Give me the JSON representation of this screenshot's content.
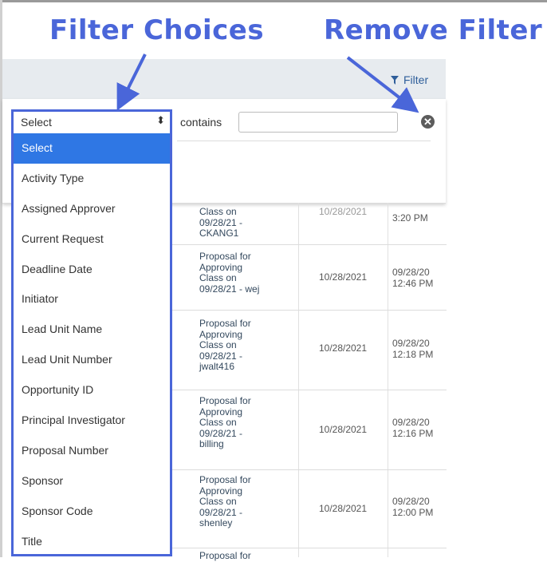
{
  "callouts": {
    "filter_choices": "Filter Choices",
    "remove_filter": "Remove Filter"
  },
  "toolbar": {
    "filter_label": "Filter"
  },
  "filter": {
    "field_selected": "Select",
    "operator_label": "contains",
    "value": "",
    "remove_icon": "close-circle-icon"
  },
  "dropdown": {
    "options": [
      "Select",
      "Activity Type",
      "Assigned Approver",
      "Current Request",
      "Deadline Date",
      "Initiator",
      "Lead Unit Name",
      "Lead Unit Number",
      "Opportunity ID",
      "Principal Investigator",
      "Proposal Number",
      "Sponsor",
      "Sponsor Code",
      "Title"
    ],
    "selected_index": 0
  },
  "table": {
    "rows": [
      {
        "desc": [
          "Class on",
          "09/28/21 -",
          "CKANG1"
        ],
        "date": "10/28/2021",
        "time": [
          "3:20 PM"
        ]
      },
      {
        "desc": [
          "Proposal for",
          "Approving",
          "Class on",
          "09/28/21 - wej"
        ],
        "date": "10/28/2021",
        "time": [
          "09/28/20",
          "12:46 PM"
        ]
      },
      {
        "desc": [
          "Proposal for",
          "Approving",
          "Class on",
          "09/28/21 -",
          "jwalt416"
        ],
        "date": "10/28/2021",
        "time": [
          "09/28/20",
          "12:18 PM"
        ]
      },
      {
        "desc": [
          "Proposal for",
          "Approving",
          "Class on",
          "09/28/21 -",
          "billing"
        ],
        "date": "10/28/2021",
        "time": [
          "09/28/20",
          "12:16 PM"
        ]
      },
      {
        "desc": [
          "Proposal for",
          "Approving",
          "Class on",
          "09/28/21 -",
          "shenley"
        ],
        "date": "10/28/2021",
        "time": [
          "09/28/20",
          "12:00 PM"
        ]
      },
      {
        "desc": [
          "Proposal for"
        ],
        "date": "",
        "time": []
      }
    ]
  },
  "colors": {
    "callout_blue": "#4a66d9",
    "selected_blue": "#2f77e4",
    "link_blue": "#2e5e9a"
  }
}
